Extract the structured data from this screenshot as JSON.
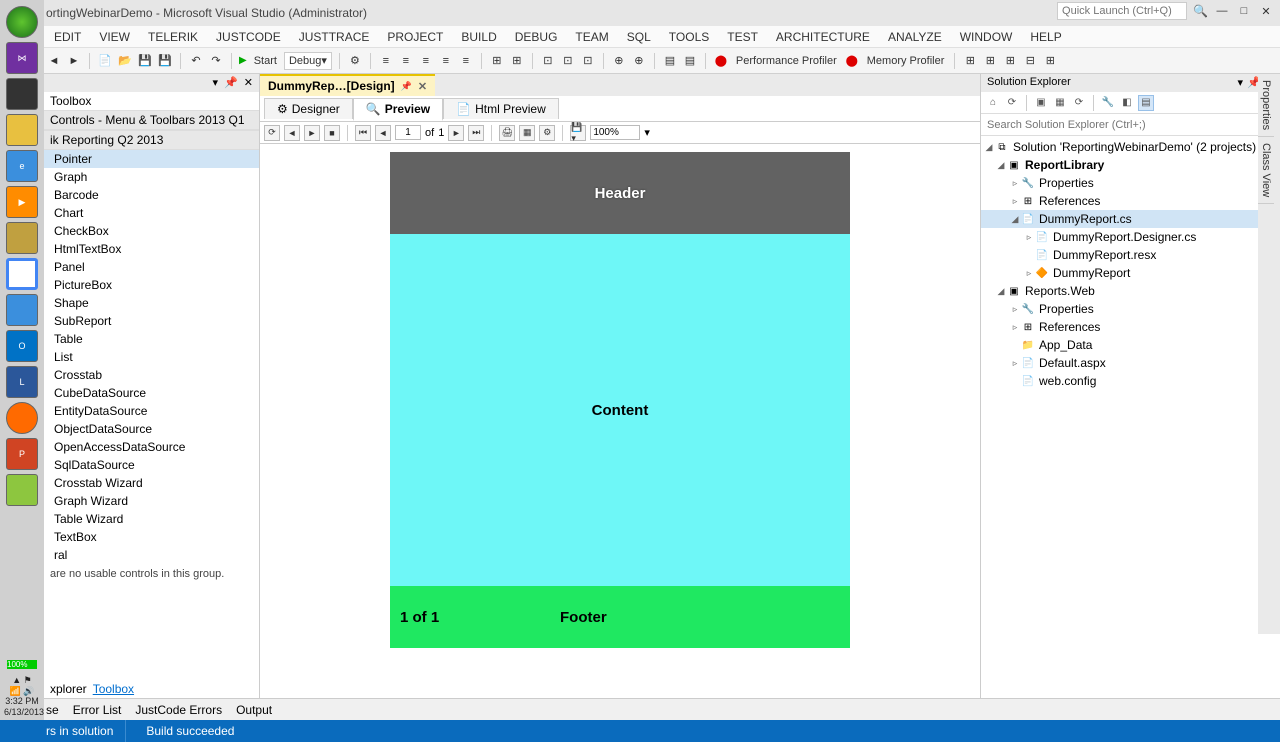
{
  "window": {
    "title": "ortingWebinarDemo - Microsoft Visual Studio (Administrator)",
    "quick_launch_placeholder": "Quick Launch (Ctrl+Q)"
  },
  "menu": [
    "EDIT",
    "VIEW",
    "TELERIK",
    "JUSTCODE",
    "JUSTTRACE",
    "PROJECT",
    "BUILD",
    "DEBUG",
    "TEAM",
    "SQL",
    "TOOLS",
    "TEST",
    "ARCHITECTURE",
    "ANALYZE",
    "WINDOW",
    "HELP"
  ],
  "toolbar": {
    "start": "Start",
    "config": "Debug",
    "perf_profiler": "Performance Profiler",
    "mem_profiler": "Memory Profiler"
  },
  "doc_tab": {
    "label": "DummyRep…[Design]"
  },
  "mode_tabs": {
    "designer": "Designer",
    "preview": "Preview",
    "html": "Html Preview"
  },
  "preview_bar": {
    "page": "1",
    "of": "of",
    "total": "1",
    "zoom": "100%"
  },
  "report": {
    "header": "Header",
    "content": "Content",
    "footer": "Footer",
    "page": "1 of 1"
  },
  "toolbox": {
    "title": "Toolbox",
    "group1": "Controls - Menu & Toolbars 2013 Q1",
    "group2": "ik Reporting Q2 2013",
    "items": [
      "Pointer",
      "Graph",
      "Barcode",
      "Chart",
      "CheckBox",
      "HtmlTextBox",
      "Panel",
      "PictureBox",
      "Shape",
      "SubReport",
      "Table",
      "List",
      "Crosstab",
      "CubeDataSource",
      "EntityDataSource",
      "ObjectDataSource",
      "OpenAccessDataSource",
      "SqlDataSource",
      "Crosstab Wizard",
      "Graph Wizard",
      "Table Wizard",
      "TextBox",
      "ral"
    ],
    "msg": "are no usable controls in this group.",
    "bottom_tabs": {
      "explorer": "xplorer",
      "toolbox": "Toolbox"
    }
  },
  "solution": {
    "title": "Solution Explorer",
    "search_placeholder": "Search Solution Explorer (Ctrl+;)",
    "root": "Solution 'ReportingWebinarDemo' (2 projects)",
    "proj1": "ReportLibrary",
    "p1_items": [
      "Properties",
      "References",
      "DummyReport.cs",
      "DummyReport.Designer.cs",
      "DummyReport.resx",
      "DummyReport"
    ],
    "proj2": "Reports.Web",
    "p2_items": [
      "Properties",
      "References",
      "App_Data",
      "Default.aspx",
      "web.config"
    ]
  },
  "right_panels": [
    "Properties",
    "Class View"
  ],
  "bottom_tabs": [
    "se",
    "Error List",
    "JustCode Errors",
    "Output"
  ],
  "status": {
    "left": "rs in solution",
    "build": "Build succeeded"
  },
  "os_tray": {
    "pct": "100%",
    "time": "3:32 PM",
    "date": "6/13/2013"
  }
}
